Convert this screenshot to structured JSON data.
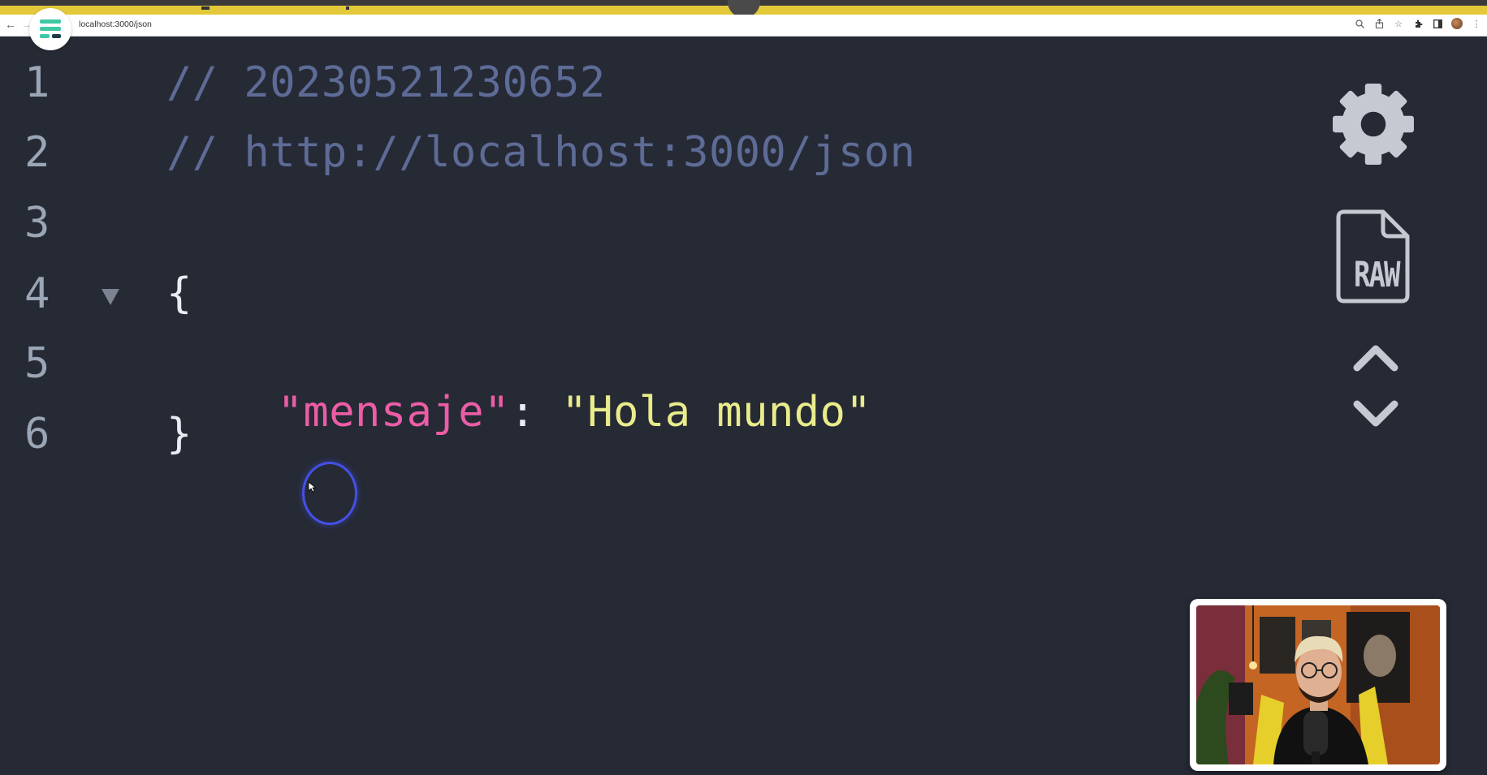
{
  "browser": {
    "url": "localhost:3000/json",
    "nav": {
      "back_icon": "back-arrow-icon",
      "forward_icon": "forward-arrow-icon"
    },
    "toolbar_icons": [
      "zoom-icon",
      "share-icon",
      "star-icon",
      "extensions-icon",
      "sidebar-icon",
      "profile-avatar",
      "menu-icon"
    ]
  },
  "viewer": {
    "line_numbers": [
      "1",
      "2",
      "3",
      "4",
      "5",
      "6"
    ],
    "lines": {
      "comment_timestamp": "// 20230521230652",
      "comment_url": "// http://localhost:3000/json",
      "open_brace": "{",
      "key": "\"mensaje\"",
      "colon": ":",
      "value": "\"Hola mundo\"",
      "close_brace": "}"
    },
    "side_controls": {
      "settings_icon": "gear-icon",
      "raw_label": "RAW",
      "collapse_icon": "chevron-up-icon",
      "expand_icon": "chevron-down-icon"
    }
  },
  "colors": {
    "background": "#262a35",
    "comment": "#5d6b96",
    "key": "#ec5da6",
    "string": "#e9ec8b",
    "line_number": "#9aa5b5",
    "accent_bar": "#e3c93a"
  }
}
